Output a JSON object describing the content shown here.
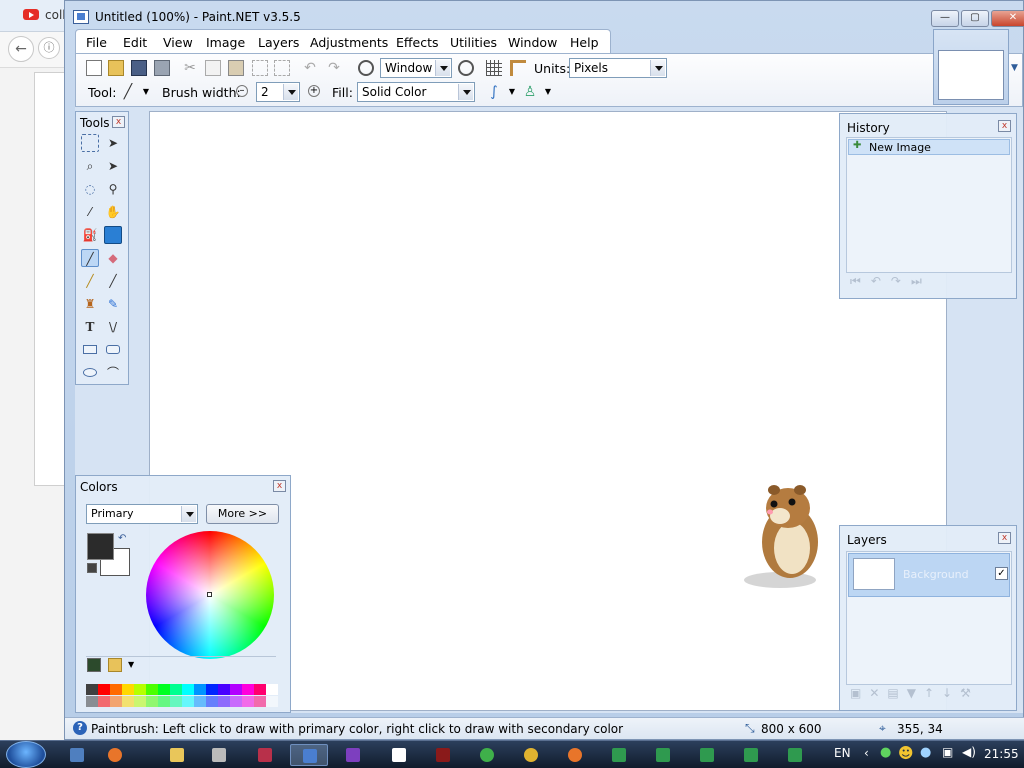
{
  "background_browser": {
    "tab_text": "coll"
  },
  "window": {
    "title": "Untitled (100%) - Paint.NET v3.5.5",
    "minimize_label": "—",
    "maximize_label": "▢",
    "close_label": "✕"
  },
  "menu": {
    "items": [
      "File",
      "Edit",
      "View",
      "Image",
      "Layers",
      "Adjustments",
      "Effects",
      "Utilities",
      "Window",
      "Help"
    ]
  },
  "toolbar": {
    "zoom_value": "Window",
    "units_label": "Units:",
    "units_value": "Pixels",
    "tool_label": "Tool:",
    "brush_width_label": "Brush width:",
    "brush_width_value": "2",
    "fill_label": "Fill:",
    "fill_value": "Solid Color"
  },
  "tools_panel": {
    "title": "Tools",
    "close_label": "x"
  },
  "history_panel": {
    "title": "History",
    "close_label": "x",
    "items": [
      "New Image"
    ]
  },
  "layers_panel": {
    "title": "Layers",
    "close_label": "x",
    "layers": [
      {
        "name": "Background",
        "visible": true
      }
    ]
  },
  "colors_panel": {
    "title": "Colors",
    "close_label": "x",
    "mode_value": "Primary",
    "more_label": "More >>",
    "primary_color": "#2b2b2b",
    "secondary_color": "#ffffff",
    "palette": [
      "#404040",
      "#ff0000",
      "#ff6a00",
      "#ffd800",
      "#b6ff00",
      "#4cff00",
      "#00ff21",
      "#00ff90",
      "#00ffff",
      "#0094ff",
      "#0026ff",
      "#4800ff",
      "#b200ff",
      "#ff00dc",
      "#ff006e",
      "#ffffff"
    ]
  },
  "status": {
    "message": "Paintbrush: Left click to draw with primary color, right click to draw with secondary color",
    "image_size": "800 x 600",
    "cursor_position": "355, 34"
  },
  "taskbar": {
    "language": "EN",
    "time": "21:55"
  }
}
